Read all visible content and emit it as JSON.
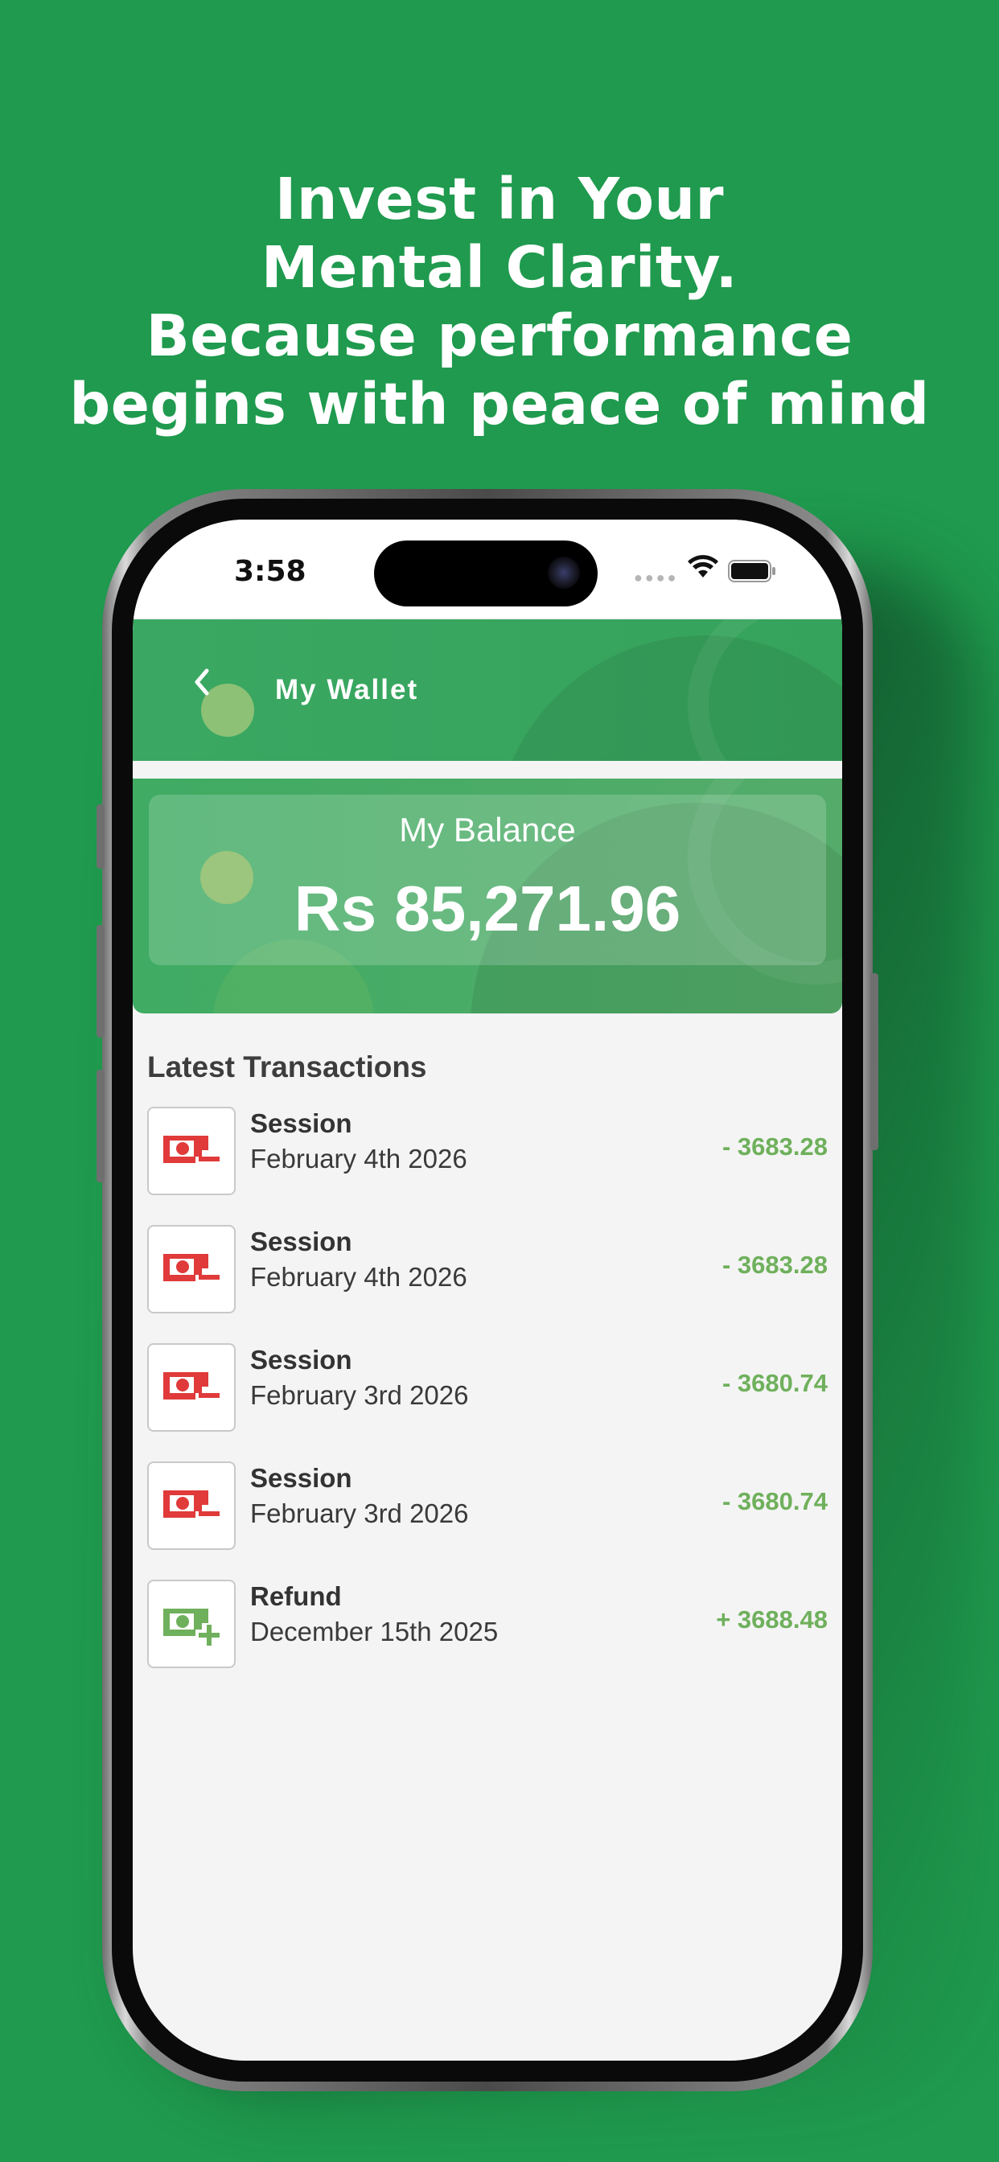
{
  "headline": [
    "Invest in Your",
    "Mental Clarity.",
    "Because performance",
    "begins with peace of mind"
  ],
  "status_bar": {
    "time": "3:58"
  },
  "header": {
    "back_icon": "chevron-left-icon",
    "title": "My Wallet"
  },
  "balance": {
    "label": "My Balance",
    "amount": "Rs 85,271.96"
  },
  "transactions_title": "Latest Transactions",
  "transactions": [
    {
      "title": "Session",
      "date": "February 4th 2026",
      "amount": "- 3683.28",
      "icon": "cash-minus-icon"
    },
    {
      "title": "Session",
      "date": "February 4th 2026",
      "amount": "- 3683.28",
      "icon": "cash-minus-icon"
    },
    {
      "title": "Session",
      "date": "February 3rd 2026",
      "amount": "- 3680.74",
      "icon": "cash-minus-icon"
    },
    {
      "title": "Session",
      "date": "February 3rd 2026",
      "amount": "- 3680.74",
      "icon": "cash-minus-icon"
    },
    {
      "title": "Refund",
      "date": "December 15th 2025",
      "amount": "+ 3688.48",
      "icon": "cash-plus-icon"
    }
  ],
  "colors": {
    "background": "#1f9a4e",
    "header_green": "#3aa862",
    "amount_green": "#6fb05c",
    "debit_red": "#e03a3a",
    "credit_green": "#6fb05c"
  }
}
